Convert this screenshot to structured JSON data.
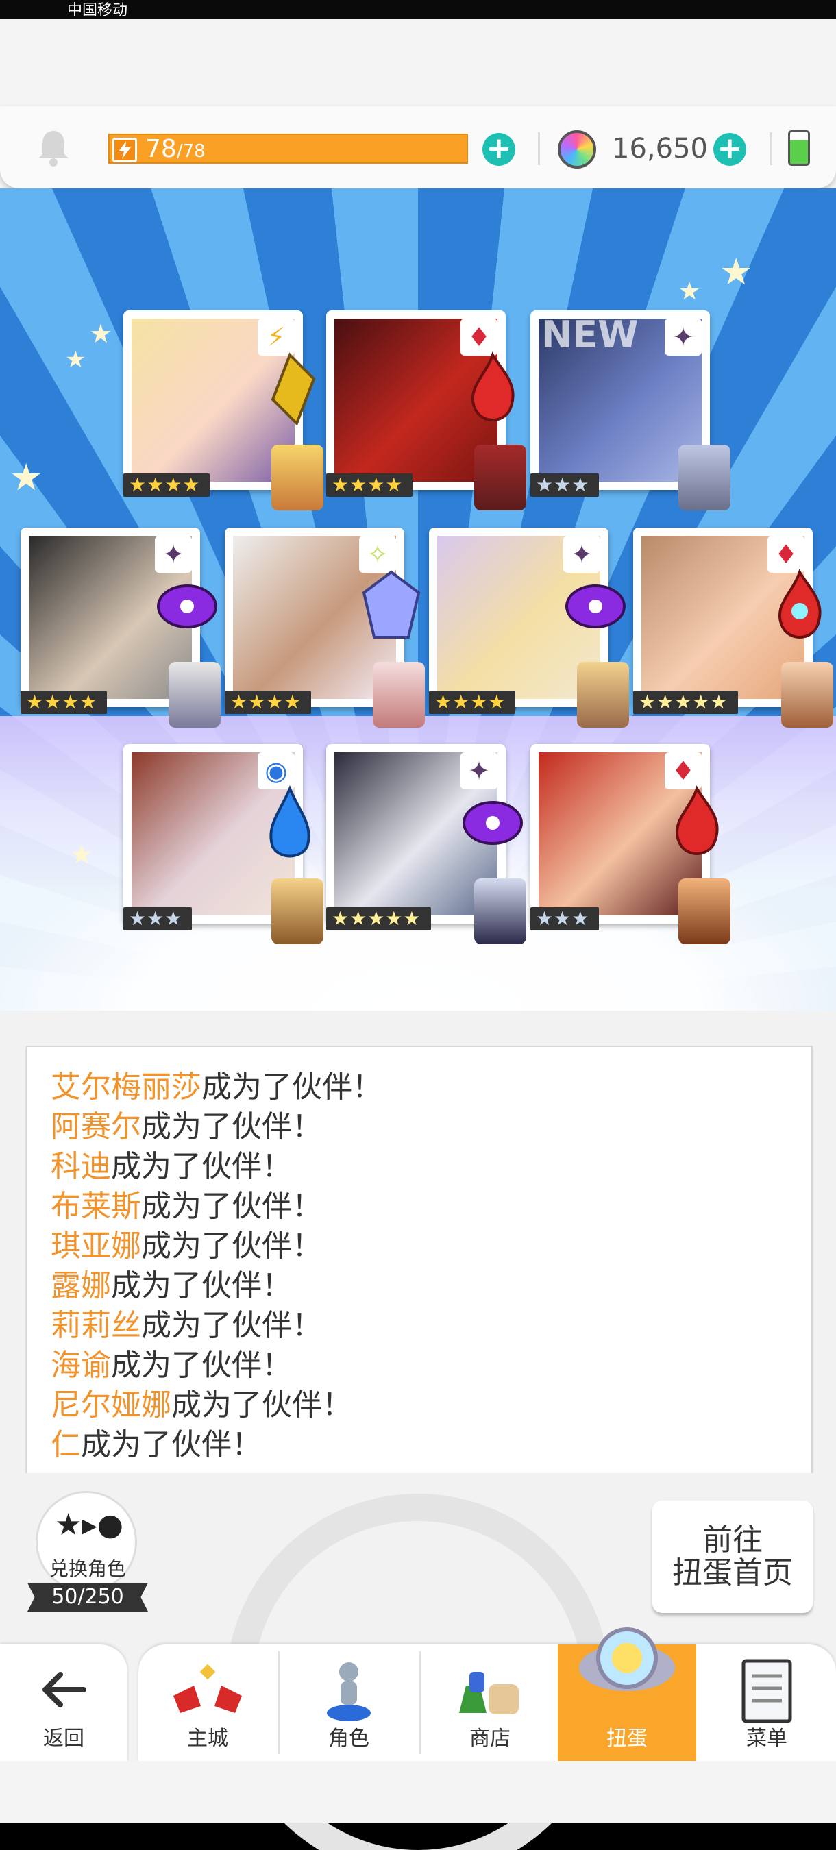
{
  "status_bar": {
    "carrier": "中国移动"
  },
  "resources": {
    "stamina_current": "78",
    "stamina_max": "/78",
    "gems": "16,650"
  },
  "cards": [
    {
      "id": "c1",
      "stars": "★★★★",
      "element": "lightning",
      "rarity": "gold"
    },
    {
      "id": "c2",
      "stars": "★★★★",
      "element": "fire",
      "rarity": "gold"
    },
    {
      "id": "c3",
      "stars": "★★★",
      "element": "dark",
      "rarity": "silver",
      "new_tag": "NEW"
    },
    {
      "id": "c4",
      "stars": "★★★★",
      "element": "dark",
      "rarity": "gold"
    },
    {
      "id": "c5",
      "stars": "★★★★",
      "element": "light",
      "rarity": "gold"
    },
    {
      "id": "c6",
      "stars": "★★★★",
      "element": "dark",
      "rarity": "gold"
    },
    {
      "id": "c7",
      "stars": "★★★★★",
      "element": "fire",
      "rarity": "rainbow"
    },
    {
      "id": "c8",
      "stars": "★★★",
      "element": "water",
      "rarity": "silver"
    },
    {
      "id": "c9",
      "stars": "★★★★★",
      "element": "dark",
      "rarity": "rainbow"
    },
    {
      "id": "c10",
      "stars": "★★★",
      "element": "fire",
      "rarity": "silver"
    }
  ],
  "log": {
    "suffix": "成为了伙伴！",
    "names": [
      "艾尔梅丽莎",
      "阿赛尔",
      "科迪",
      "布莱斯",
      "琪亚娜",
      "露娜",
      "莉莉丝",
      "海谕",
      "尼尔娅娜",
      "仁"
    ]
  },
  "exchange": {
    "label": "兑换角色",
    "count": "50/250"
  },
  "goto_button": {
    "line1": "前往",
    "line2": "扭蛋首页"
  },
  "nav": {
    "back": "返回",
    "items": [
      "主城",
      "角色",
      "商店",
      "扭蛋",
      "菜单"
    ],
    "active_index": 3
  },
  "colors": {
    "accent": "#f9a62a",
    "name_highlight": "#f2922b",
    "stamina": "#f9a025",
    "plus": "#1ec0b4"
  }
}
